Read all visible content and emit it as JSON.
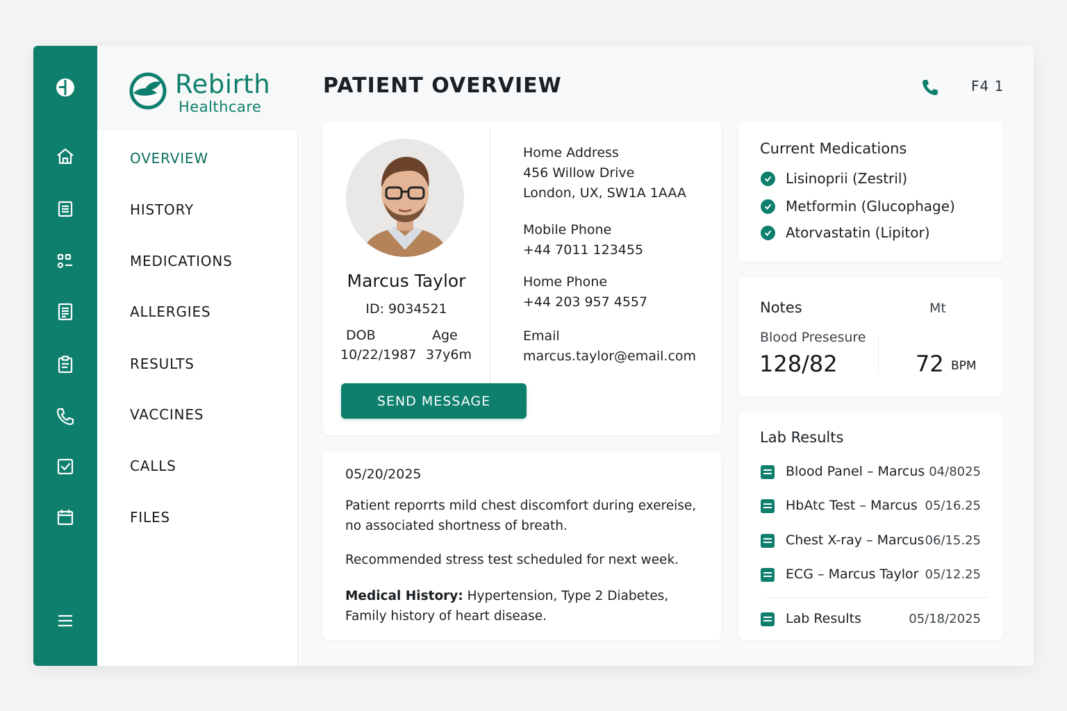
{
  "brand": {
    "name": "Rebirth",
    "subtitle": "Healthcare"
  },
  "rail": {
    "icons": [
      "cross-logo-icon",
      "home-icon",
      "document-icon",
      "apps-icon",
      "receipt-icon",
      "clipboard-icon",
      "phone-icon",
      "checkbox-icon",
      "calendar-icon",
      "menu-icon"
    ]
  },
  "nav": {
    "items": [
      {
        "label": "OVERVIEW",
        "active": true
      },
      {
        "label": "HISTORY"
      },
      {
        "label": "MEDICATIONS"
      },
      {
        "label": "ALLERGIES"
      },
      {
        "label": "RESULTS"
      },
      {
        "label": "VACCINES"
      },
      {
        "label": "CALLS"
      },
      {
        "label": "FILES"
      }
    ]
  },
  "header": {
    "title": "PATIENT OVERVIEW",
    "code": "F4 1"
  },
  "patient": {
    "name": "Marcus Taylor",
    "id": "ID: 9034521",
    "dob_label": "DOB",
    "dob": "10/22/1987",
    "age_label": "Age",
    "age": "37y6m",
    "send_label": "SEND MESSAGE"
  },
  "contact": {
    "address_label": "Home Address",
    "address_line1": "456 Willow Drive",
    "address_line2": "London, UX, SW1A 1AAA",
    "mobile_label": "Mobile Phone",
    "mobile": "+44 7011 123455",
    "home_label": "Home Phone",
    "home": "+44 203 957 4557",
    "email_label": "Email",
    "email": "marcus.taylor@email.com"
  },
  "note": {
    "date": "05/20/2025",
    "text1": "Patient reporrts mild chest discomfort during exereise, no associated shortness of breath.",
    "text2": "Recommended stress test scheduled for next week.",
    "history_label": "Medical History:",
    "history_text": " Hypertension, Type 2 Diabetes, Family history of heart disease."
  },
  "medications": {
    "title": "Current Medications",
    "items": [
      "Lisinoprii (Zestril)",
      "Metformin (Glucophage)",
      "Atorvastatin (Lipitor)"
    ]
  },
  "vitals": {
    "title": "Notes",
    "extra": "Mt",
    "bp_label": "Blood Presesure",
    "bp": "128/82",
    "hr": "72",
    "hr_unit": "BPM"
  },
  "labs": {
    "title": "Lab Results",
    "items": [
      {
        "name": "Blood Panel – Marcus",
        "date": "04/8025"
      },
      {
        "name": "HbAtc Test – Marcus",
        "date": "05/16.25"
      },
      {
        "name": "Chest X-ray – Marcus",
        "date": "06/15.25"
      },
      {
        "name": "ECG – Marcus Taylor",
        "date": "05/12.25"
      },
      {
        "name": "Lab Results",
        "date": "05/18/2025"
      }
    ]
  },
  "colors": {
    "accent": "#0e7f6d",
    "background": "#f3f4f6",
    "card": "#ffffff"
  }
}
